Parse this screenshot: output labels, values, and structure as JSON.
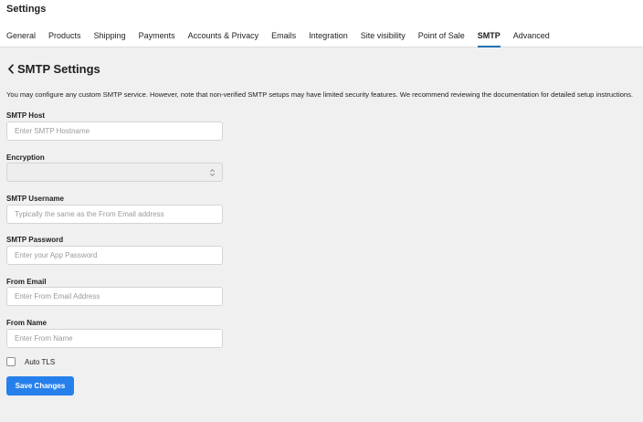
{
  "header": {
    "title": "Settings",
    "tabs": [
      {
        "label": "General"
      },
      {
        "label": "Products"
      },
      {
        "label": "Shipping"
      },
      {
        "label": "Payments"
      },
      {
        "label": "Accounts & Privacy"
      },
      {
        "label": "Emails"
      },
      {
        "label": "Integration"
      },
      {
        "label": "Site visibility"
      },
      {
        "label": "Point of Sale"
      },
      {
        "label": "SMTP",
        "active": true
      },
      {
        "label": "Advanced"
      }
    ]
  },
  "main": {
    "title": "SMTP Settings",
    "description": "You may configure any custom SMTP service. However, note that non-verified SMTP setups may have limited security features. We recommend reviewing the documentation for detailed setup instructions.",
    "fields": {
      "host": {
        "label": "SMTP Host",
        "placeholder": "Enter SMTP Hostname",
        "value": ""
      },
      "encryption": {
        "label": "Encryption",
        "value": ""
      },
      "username": {
        "label": "SMTP Username",
        "placeholder": "Typically the same as the From Email address",
        "value": ""
      },
      "password": {
        "label": "SMTP Password",
        "placeholder": "Enter your App Password",
        "value": ""
      },
      "from_email": {
        "label": "From Email",
        "placeholder": "Enter From Email Address",
        "value": ""
      },
      "from_name": {
        "label": "From Name",
        "placeholder": "Enter From Name",
        "value": ""
      }
    },
    "auto_tls": {
      "label": "Auto TLS",
      "checked": false
    },
    "save_label": "Save Changes"
  },
  "icons": {
    "back": "chevron-left-icon",
    "select": "select-arrows-icon"
  },
  "colors": {
    "accent": "#2680eb",
    "active_tab_underline": "#2271b1",
    "page_background": "#f0f0f0"
  }
}
